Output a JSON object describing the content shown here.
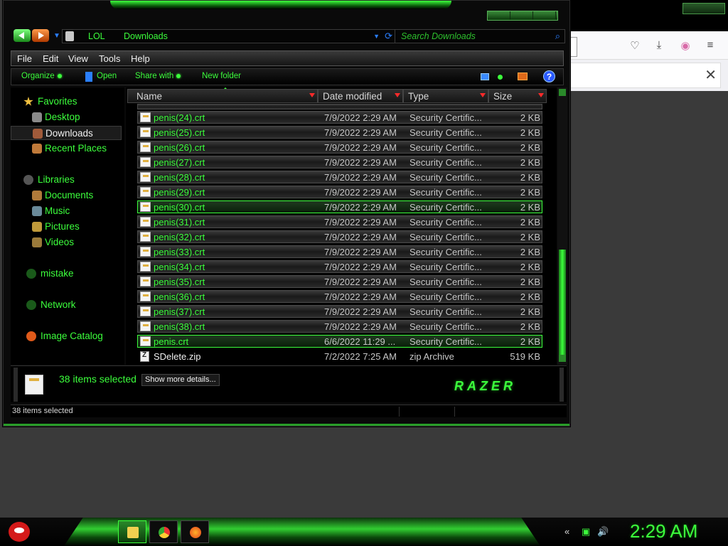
{
  "explorer": {
    "address": {
      "crumbs": [
        "LOL",
        "Downloads"
      ]
    },
    "search": {
      "placeholder": "Search Downloads"
    },
    "menu": [
      "File",
      "Edit",
      "View",
      "Tools",
      "Help"
    ],
    "commands": {
      "organize": "Organize",
      "open": "Open",
      "share": "Share with",
      "new_folder": "New folder"
    },
    "nav": {
      "favorites": "Favorites",
      "desktop": "Desktop",
      "downloads": "Downloads",
      "recent": "Recent Places",
      "libraries": "Libraries",
      "documents": "Documents",
      "music": "Music",
      "pictures": "Pictures",
      "videos": "Videos",
      "mistake": "mistake",
      "network": "Network",
      "image_catalog": "Image Catalog"
    },
    "columns": {
      "name": "Name",
      "date": "Date modified",
      "type": "Type",
      "size": "Size"
    },
    "files": [
      {
        "name": "penis(24).crt",
        "date": "7/9/2022 2:29 AM",
        "type": "Security Certific...",
        "size": "2 KB"
      },
      {
        "name": "penis(25).crt",
        "date": "7/9/2022 2:29 AM",
        "type": "Security Certific...",
        "size": "2 KB"
      },
      {
        "name": "penis(26).crt",
        "date": "7/9/2022 2:29 AM",
        "type": "Security Certific...",
        "size": "2 KB"
      },
      {
        "name": "penis(27).crt",
        "date": "7/9/2022 2:29 AM",
        "type": "Security Certific...",
        "size": "2 KB"
      },
      {
        "name": "penis(28).crt",
        "date": "7/9/2022 2:29 AM",
        "type": "Security Certific...",
        "size": "2 KB"
      },
      {
        "name": "penis(29).crt",
        "date": "7/9/2022 2:29 AM",
        "type": "Security Certific...",
        "size": "2 KB"
      },
      {
        "name": "penis(30).crt",
        "date": "7/9/2022 2:29 AM",
        "type": "Security Certific...",
        "size": "2 KB"
      },
      {
        "name": "penis(31).crt",
        "date": "7/9/2022 2:29 AM",
        "type": "Security Certific...",
        "size": "2 KB"
      },
      {
        "name": "penis(32).crt",
        "date": "7/9/2022 2:29 AM",
        "type": "Security Certific...",
        "size": "2 KB"
      },
      {
        "name": "penis(33).crt",
        "date": "7/9/2022 2:29 AM",
        "type": "Security Certific...",
        "size": "2 KB"
      },
      {
        "name": "penis(34).crt",
        "date": "7/9/2022 2:29 AM",
        "type": "Security Certific...",
        "size": "2 KB"
      },
      {
        "name": "penis(35).crt",
        "date": "7/9/2022 2:29 AM",
        "type": "Security Certific...",
        "size": "2 KB"
      },
      {
        "name": "penis(36).crt",
        "date": "7/9/2022 2:29 AM",
        "type": "Security Certific...",
        "size": "2 KB"
      },
      {
        "name": "penis(37).crt",
        "date": "7/9/2022 2:29 AM",
        "type": "Security Certific...",
        "size": "2 KB"
      },
      {
        "name": "penis(38).crt",
        "date": "7/9/2022 2:29 AM",
        "type": "Security Certific...",
        "size": "2 KB"
      },
      {
        "name": "penis.crt",
        "date": "6/6/2022 11:29 ...",
        "type": "Security Certific...",
        "size": "2 KB"
      },
      {
        "name": "SDelete.zip",
        "date": "7/2/2022 7:25 AM",
        "type": "zip Archive",
        "size": "519 KB"
      }
    ],
    "details": {
      "count": "38 items selected",
      "more": "Show more details...",
      "logo": "RAZER"
    },
    "status": "38 items selected"
  },
  "taskbar": {
    "clock": "2:29 AM"
  },
  "colors": {
    "accent": "#3cff3c",
    "background": "#000000",
    "error_arrow": "#ff2a2a"
  }
}
